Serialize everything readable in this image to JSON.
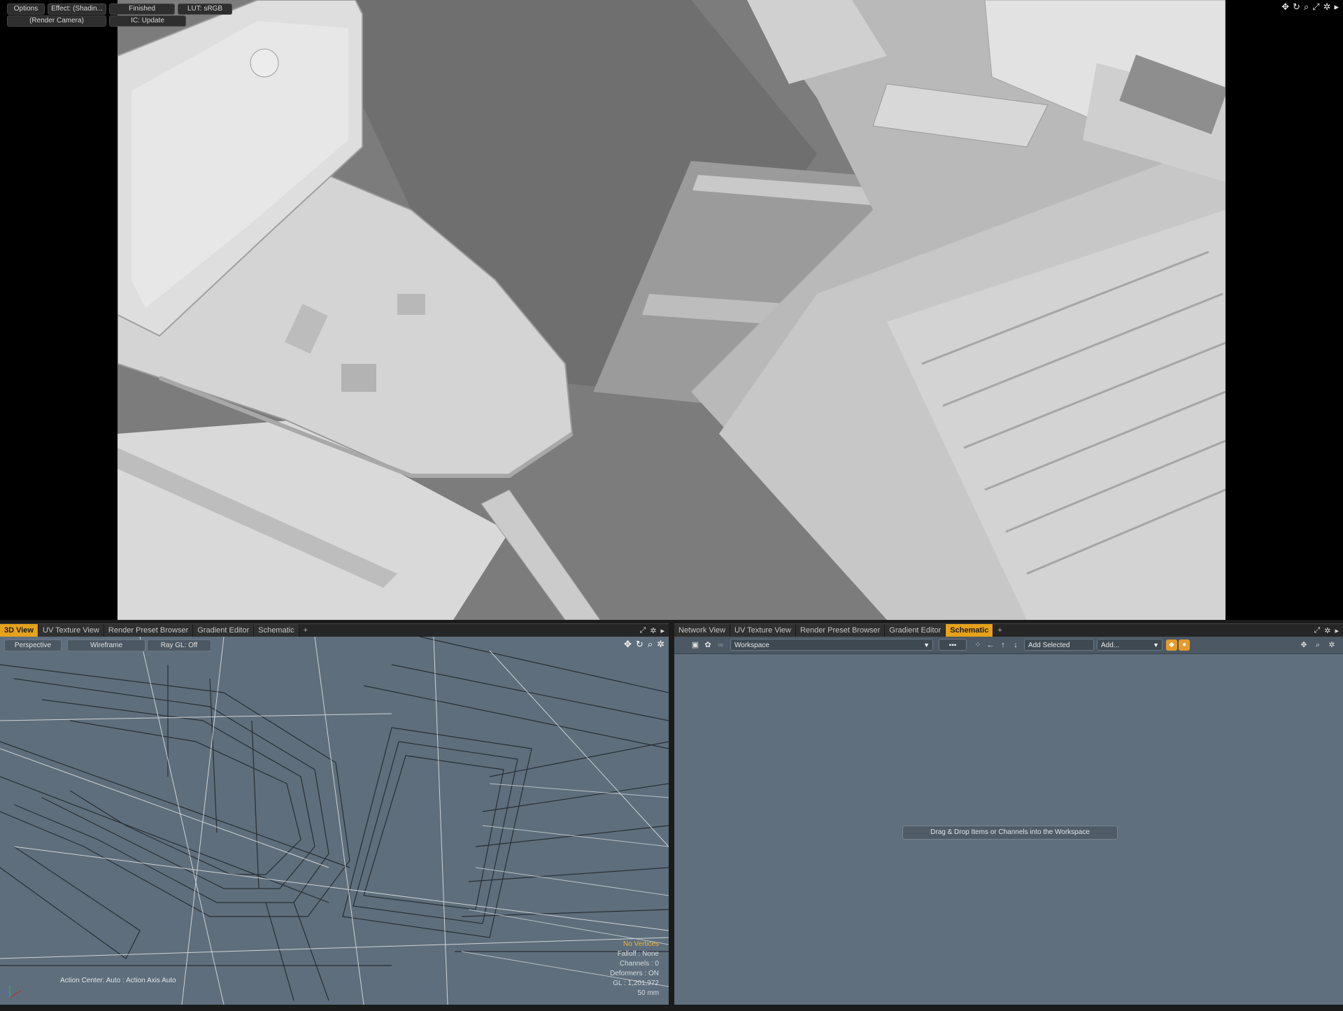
{
  "render_view": {
    "toolbar_row1": [
      "Options",
      "Effect: (Shadin...",
      "Finished",
      "LUT: sRGB"
    ],
    "toolbar_row2": [
      "(Render Camera)",
      "IC: Update"
    ],
    "icons": [
      "move-icon",
      "rotate-icon",
      "zoom-icon",
      "maximize-icon",
      "gear-icon",
      "arrow-icon"
    ]
  },
  "left_panel": {
    "tabs": [
      "3D View",
      "UV Texture View",
      "Render Preset Browser",
      "Gradient Editor",
      "Schematic"
    ],
    "active_tab": "3D View",
    "add_tab": "+",
    "viewport": {
      "projection": "Perspective",
      "shading": "Wireframe",
      "raygl": "Ray GL: Off"
    },
    "info": {
      "selection": "No Vertices",
      "channels_label": "Channels : 0",
      "falloff": "Falloff : None",
      "deformers": "Deformers : ON",
      "gl": "GL : 1,201,972",
      "units": "50 mm",
      "action_center": "Action Center: Auto : Action Axis Auto"
    }
  },
  "right_panel": {
    "tabs": [
      "Network View",
      "UV Texture View",
      "Render Preset Browser",
      "Gradient Editor",
      "Schematic"
    ],
    "active_tab": "Schematic",
    "add_tab": "+",
    "workspace_select": "Workspace",
    "add_selected": "Add Selected",
    "add_menu": "Add...",
    "drop_hint": "Drag & Drop Items or Channels into the Workspace"
  },
  "colors": {
    "accent": "#e6a21a",
    "viewport_bg": "#5e6e7c",
    "schematic_bg": "#5f6f7d",
    "render_bg": "#d6d6d6"
  }
}
